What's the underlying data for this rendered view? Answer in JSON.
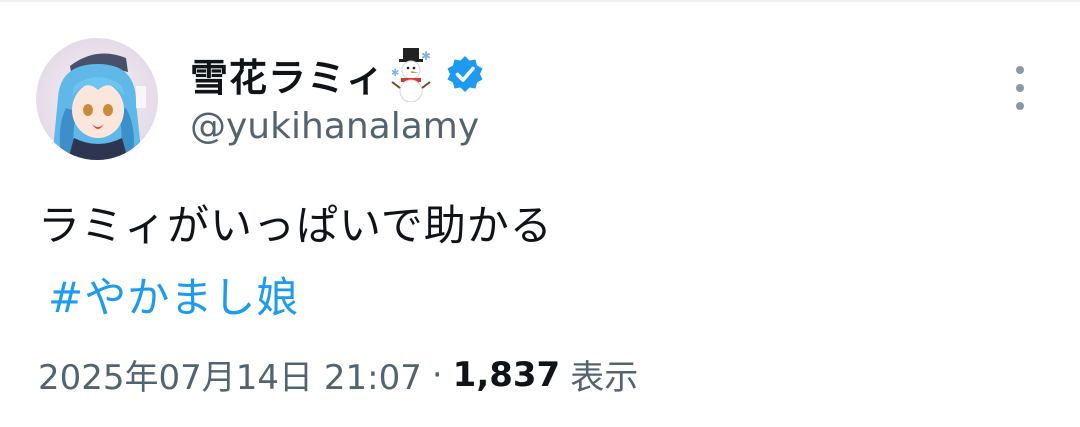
{
  "author": {
    "display_name": "雪花ラミィ",
    "name_emoji": "snowman-emoji",
    "verified_icon": "verified-badge-icon",
    "handle": "@yukihanalamy",
    "avatar_icon": "avatar"
  },
  "tweet": {
    "text": "ラミィがいっぱいで助かる",
    "hashtag": "#やかまし娘"
  },
  "meta": {
    "timestamp": "2025年07月14日 21:07",
    "separator": "·",
    "view_count": "1,837",
    "view_label": "表示"
  },
  "menu": {
    "icon": "more-options-icon"
  },
  "colors": {
    "text": "#0f1419",
    "secondary": "#536471",
    "accent": "#1d9bf0"
  }
}
